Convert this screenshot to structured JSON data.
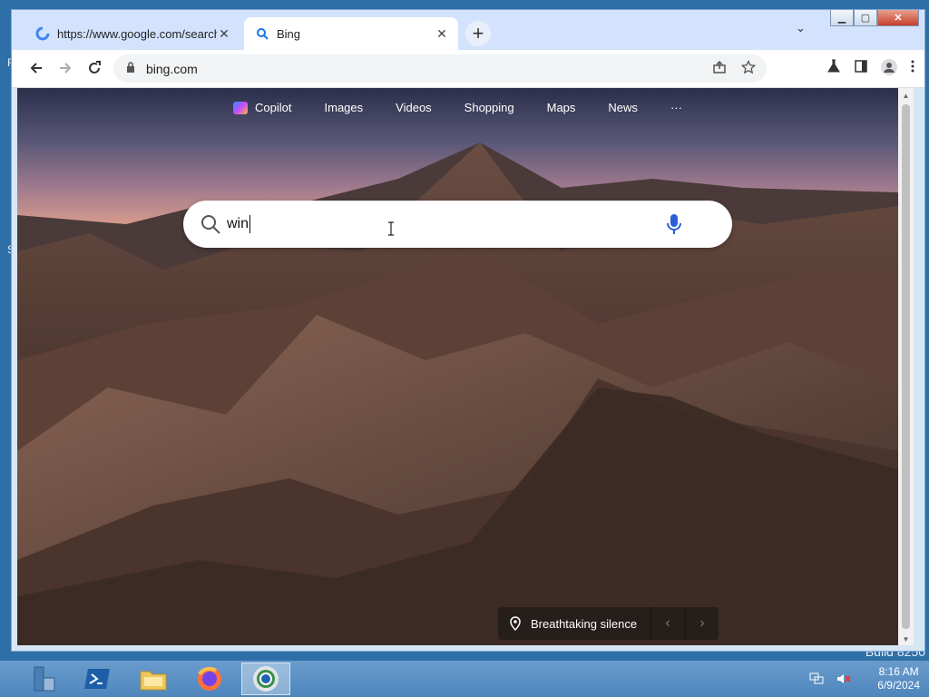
{
  "browser": {
    "tabs": [
      {
        "title": "https://www.google.com/search",
        "favicon": "google-g-icon"
      },
      {
        "title": "Bing",
        "favicon": "search-icon"
      }
    ],
    "new_tab": "+",
    "url": "bing.com"
  },
  "bing": {
    "nav": [
      {
        "label": "Copilot"
      },
      {
        "label": "Images"
      },
      {
        "label": "Videos"
      },
      {
        "label": "Shopping"
      },
      {
        "label": "Maps"
      },
      {
        "label": "News"
      },
      {
        "label": "···"
      }
    ],
    "search": {
      "query": "win"
    },
    "caption": "Breathtaking silence"
  },
  "desktop": {
    "build": "Build 8250"
  },
  "taskbar": {
    "time": "8:16 AM",
    "date": "6/9/2024"
  },
  "colors": {
    "tabstrip": "#d3e3fd",
    "taskbar": "#5b92c5",
    "accent_mic": "#2c5fd6"
  }
}
